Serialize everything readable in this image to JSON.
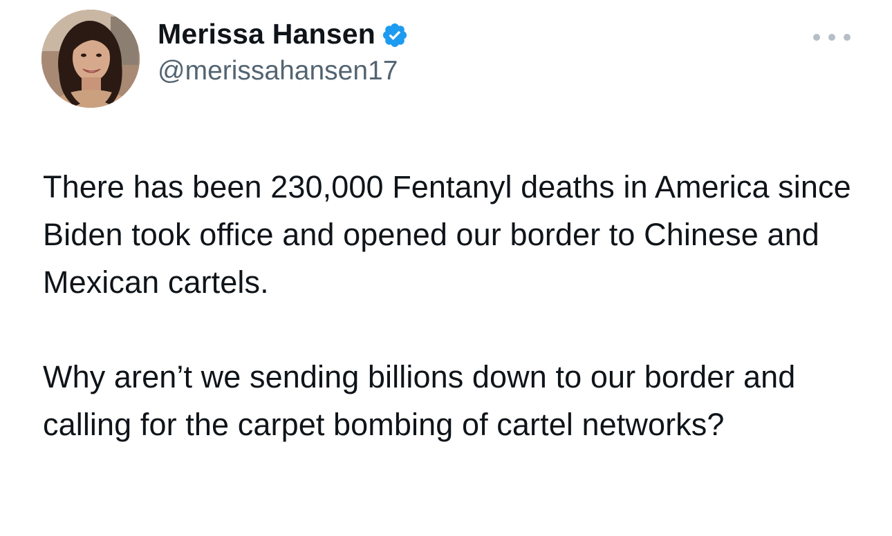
{
  "author": {
    "display_name": "Merissa Hansen",
    "handle": "@merissahansen17",
    "verified": true,
    "verified_color": "#1d9bf0"
  },
  "icons": {
    "verified": "verified-badge-icon",
    "more": "more-options-icon"
  },
  "tweet": {
    "paragraph_1": "There has been 230,000 Fentanyl deaths in America since Biden took office and opened our border to Chinese and Mexican cartels.",
    "paragraph_2": "Why aren’t we sending billions down to our border and calling for the carpet bombing of cartel networks?"
  },
  "colors": {
    "text_primary": "#0f1419",
    "text_secondary": "#536471",
    "background": "#ffffff"
  }
}
